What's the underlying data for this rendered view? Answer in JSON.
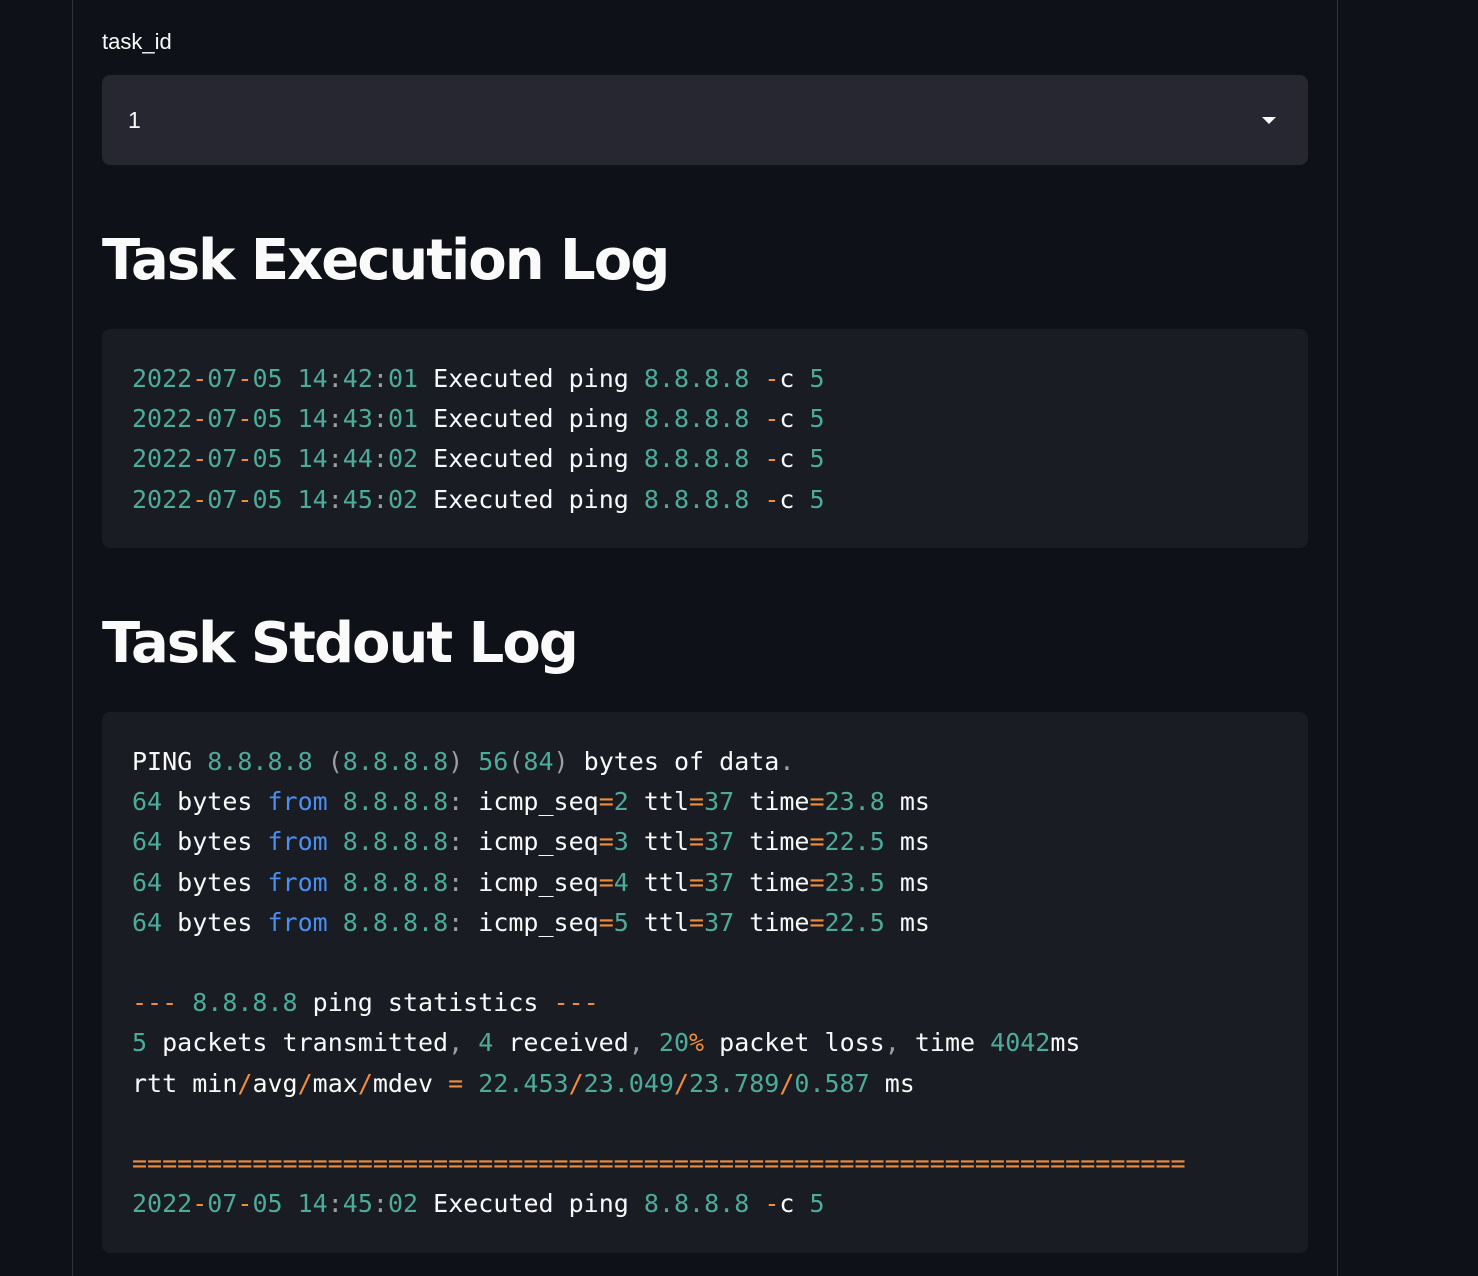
{
  "select": {
    "label": "task_id",
    "value": "1"
  },
  "exec_log": {
    "title": "Task Execution Log",
    "lines": [
      "2022-07-05 14:42:01 Executed ping 8.8.8.8 -c 5",
      "2022-07-05 14:43:01 Executed ping 8.8.8.8 -c 5",
      "2022-07-05 14:44:02 Executed ping 8.8.8.8 -c 5",
      "2022-07-05 14:45:02 Executed ping 8.8.8.8 -c 5"
    ]
  },
  "stdout_log": {
    "title": "Task Stdout Log",
    "lines": [
      "PING 8.8.8.8 (8.8.8.8) 56(84) bytes of data.",
      "64 bytes from 8.8.8.8: icmp_seq=2 ttl=37 time=23.8 ms",
      "64 bytes from 8.8.8.8: icmp_seq=3 ttl=37 time=22.5 ms",
      "64 bytes from 8.8.8.8: icmp_seq=4 ttl=37 time=23.5 ms",
      "64 bytes from 8.8.8.8: icmp_seq=5 ttl=37 time=22.5 ms",
      "",
      "--- 8.8.8.8 ping statistics ---",
      "5 packets transmitted, 4 received, 20% packet loss, time 4042ms",
      "rtt min/avg/max/mdev = 22.453/23.049/23.789/0.587 ms",
      "",
      "======================================================================",
      "2022-07-05 14:45:02 Executed ping 8.8.8.8 -c 5"
    ]
  },
  "colors": {
    "background": "#0e1117",
    "select_bg": "#262730",
    "code_bg": "#1a1c24",
    "number": "#4dab9a",
    "operator": "#f08c3c",
    "keyword": "#4b8ef0"
  }
}
